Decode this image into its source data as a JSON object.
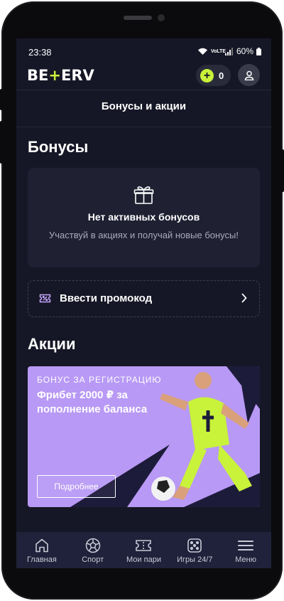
{
  "status_bar": {
    "time": "23:38",
    "network": "VoLTE",
    "battery": "60%"
  },
  "header": {
    "logo_part1": "BE",
    "logo_accent": "+",
    "logo_part2": "ERV",
    "balance": "0"
  },
  "page": {
    "title": "Бонусы и акции"
  },
  "bonuses": {
    "heading": "Бонусы",
    "empty_title": "Нет активных бонусов",
    "empty_text": "Участвуй в акциях и получай новые бонусы!",
    "promo_label": "Ввести промокод"
  },
  "promotions": {
    "heading": "Акции",
    "banner": {
      "kicker": "БОНУС ЗА РЕГИСТРАЦИЮ",
      "title": "Фрибет 2000 ₽ за пополнение баланса",
      "button": "Подробнее"
    }
  },
  "tabbar": {
    "items": [
      {
        "label": "Главная",
        "icon": "home-icon"
      },
      {
        "label": "Спорт",
        "icon": "soccer-ball-icon"
      },
      {
        "label": "Мои пари",
        "icon": "ticket-icon"
      },
      {
        "label": "Игры 24/7",
        "icon": "dice-icon"
      },
      {
        "label": "Меню",
        "icon": "menu-icon"
      }
    ]
  },
  "colors": {
    "background": "#161726",
    "card": "#1f2032",
    "accent": "#c9f23b",
    "banner": "#b899f5",
    "tabbar": "#20213a"
  }
}
